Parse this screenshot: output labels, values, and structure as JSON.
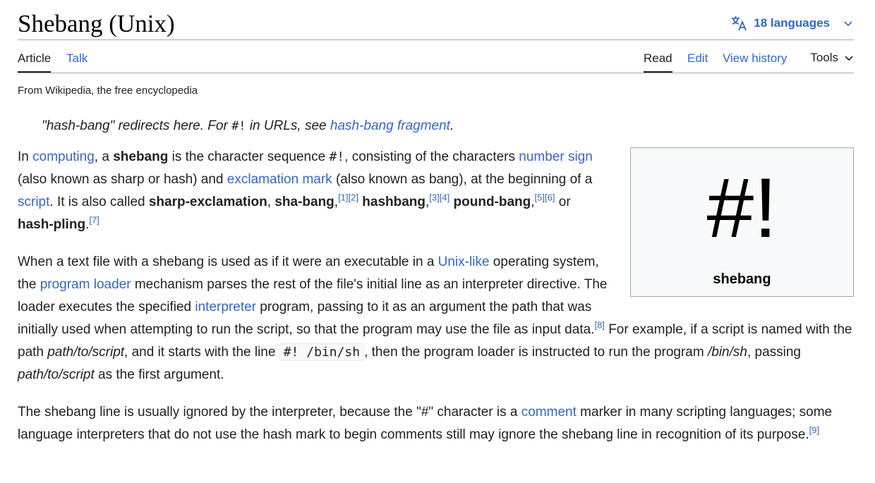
{
  "title": "Shebang (Unix)",
  "languages": {
    "icon": "translate-icon",
    "label": "18 languages",
    "chevron": "chevron-down-icon"
  },
  "tabs_left": [
    "Article",
    "Talk"
  ],
  "tabs_right": [
    "Read",
    "Edit",
    "View history"
  ],
  "tools_label": "Tools",
  "tagline": "From Wikipedia, the free encyclopedia",
  "hatnote": {
    "pre": "\"hash-bang\" redirects here. For ",
    "code": "#!",
    "mid": " in URLs, see ",
    "link": "hash-bang fragment",
    "post": "."
  },
  "infobox": {
    "glyph": "#!",
    "caption": "shebang"
  },
  "p1": {
    "t1": "In ",
    "l1": "computing",
    "t2": ", a ",
    "b1": "shebang",
    "t3": " is the character sequence ",
    "code": "#!",
    "t4": ", consisting of the characters ",
    "l2": "number sign",
    "t5": " (also known as sharp or hash) and ",
    "l3": "exclamation mark",
    "t6": " (also known as bang), at the beginning of a ",
    "l4": "script",
    "t7": ". It is also called ",
    "b2": "sharp-exclamation",
    "t8": ", ",
    "b3": "sha-bang",
    "r1": "[1]",
    "r2": "[2]",
    "t9": " ",
    "b4": "hashbang",
    "r3": "[3]",
    "r4": "[4]",
    "t10": " ",
    "b5": "pound-bang",
    "r5": "[5]",
    "r6": "[6]",
    "t11": " or ",
    "b6": "hash-pling",
    "r7": "[7]"
  },
  "p2": {
    "t1": "When a text file with a shebang is used as if it were an executable in a ",
    "l1": "Unix-like",
    "t2": " operating system, the ",
    "l2": "program loader",
    "t3": " mechanism parses the rest of the file's initial line as an interpreter directive. The loader executes the specified ",
    "l3": "interpreter",
    "t4": " program, passing to it as an argument the path that was initially used when attempting to run the script, so that the program may use the file as input data.",
    "r8": "[8]",
    "t5": " For example, if a script is named with the path ",
    "i1": "path/to/script",
    "t6": ", and it starts with the line ",
    "code": "#! /bin/sh",
    "t7": ", then the program loader is instructed to run the program ",
    "i2": "/bin/sh",
    "t8": ", passing ",
    "i3": "path/to/script",
    "t9": " as the first argument."
  },
  "p3": {
    "t1": "The shebang line is usually ignored by the interpreter, because the \"#\" character is a ",
    "l1": "comment",
    "t2": " marker in many scripting languages; some language interpreters that do not use the hash mark to begin comments still may ignore the shebang line in recognition of its purpose.",
    "r9": "[9]"
  },
  "colors": {
    "link": "#3366cc",
    "text": "#202122",
    "border": "#a2a9b1",
    "infobox_bg": "#f8f9fa"
  }
}
